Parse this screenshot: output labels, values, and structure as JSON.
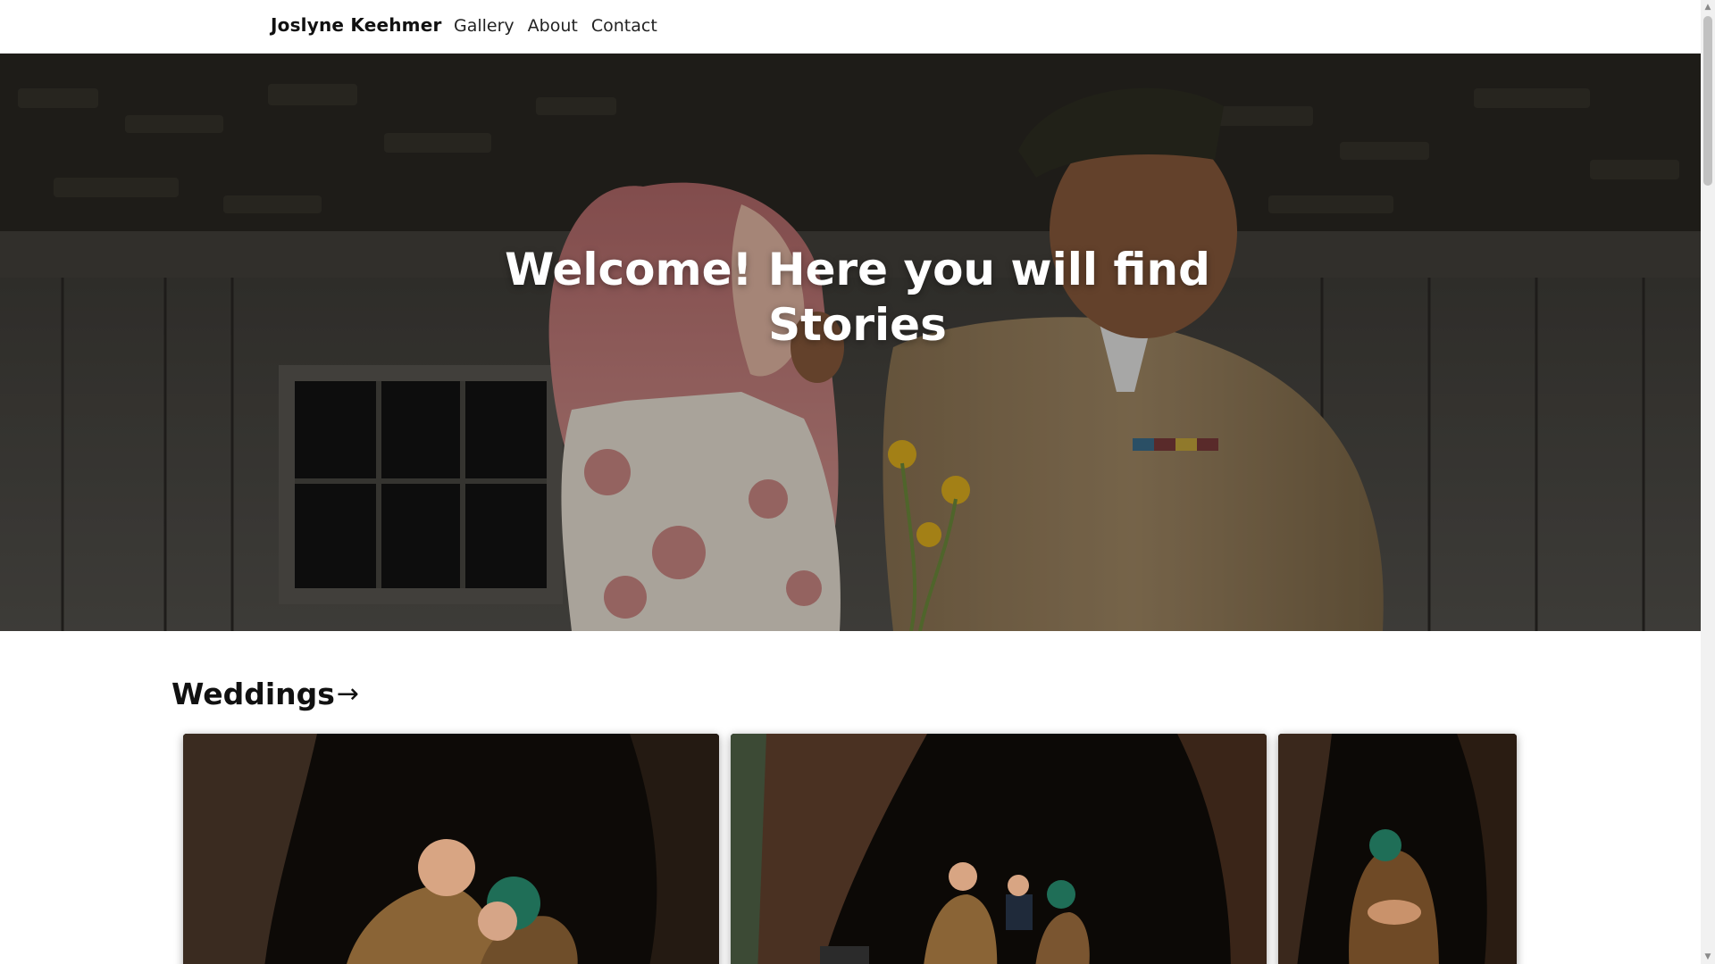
{
  "navbar": {
    "brand": "Joslyne Keehmer",
    "links": [
      "Gallery",
      "About",
      "Contact"
    ]
  },
  "hero": {
    "title": "Welcome! Here you will find Stories",
    "image": "couple-portrait-photo"
  },
  "sections": {
    "weddings": {
      "heading": "Weddings",
      "arrow": "→",
      "cards": [
        "wedding-kiss-photo",
        "wedding-ceremony-photo",
        "wedding-hug-photo"
      ]
    }
  },
  "colors": {
    "text": "#111111",
    "hero_text": "#ffffff",
    "background": "#ffffff"
  }
}
